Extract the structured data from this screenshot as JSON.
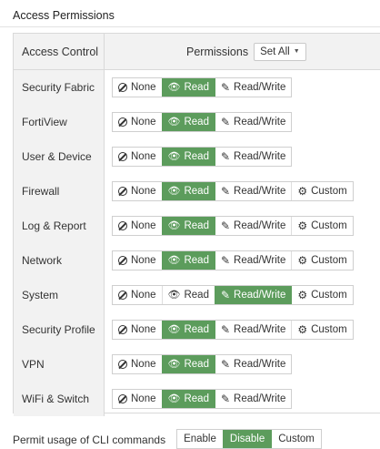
{
  "section_title": "Access Permissions",
  "table": {
    "col_access_control": "Access Control",
    "col_permissions": "Permissions",
    "set_all_label": "Set All"
  },
  "option_labels": {
    "none": "None",
    "read": "Read",
    "read_write": "Read/Write",
    "custom": "Custom"
  },
  "rows": [
    {
      "label": "Security Fabric",
      "selected": "Read",
      "has_custom": false
    },
    {
      "label": "FortiView",
      "selected": "Read",
      "has_custom": false
    },
    {
      "label": "User & Device",
      "selected": "Read",
      "has_custom": false
    },
    {
      "label": "Firewall",
      "selected": "Read",
      "has_custom": true
    },
    {
      "label": "Log & Report",
      "selected": "Read",
      "has_custom": true
    },
    {
      "label": "Network",
      "selected": "Read",
      "has_custom": true
    },
    {
      "label": "System",
      "selected": "Read/Write",
      "has_custom": true
    },
    {
      "label": "Security Profile",
      "selected": "Read",
      "has_custom": true
    },
    {
      "label": "VPN",
      "selected": "Read",
      "has_custom": false
    },
    {
      "label": "WiFi & Switch",
      "selected": "Read",
      "has_custom": false
    }
  ],
  "cli": {
    "label": "Permit usage of CLI commands",
    "options": [
      "Enable",
      "Disable",
      "Custom"
    ],
    "selected": "Disable"
  },
  "colors": {
    "active_green": "#5c9c5c",
    "header_gray": "#f2f2f2"
  },
  "icons": {
    "none": "ban-icon",
    "read": "eye-icon",
    "read_write": "pencil-icon",
    "custom": "gear-icon",
    "set_all": "caret-down-icon"
  }
}
